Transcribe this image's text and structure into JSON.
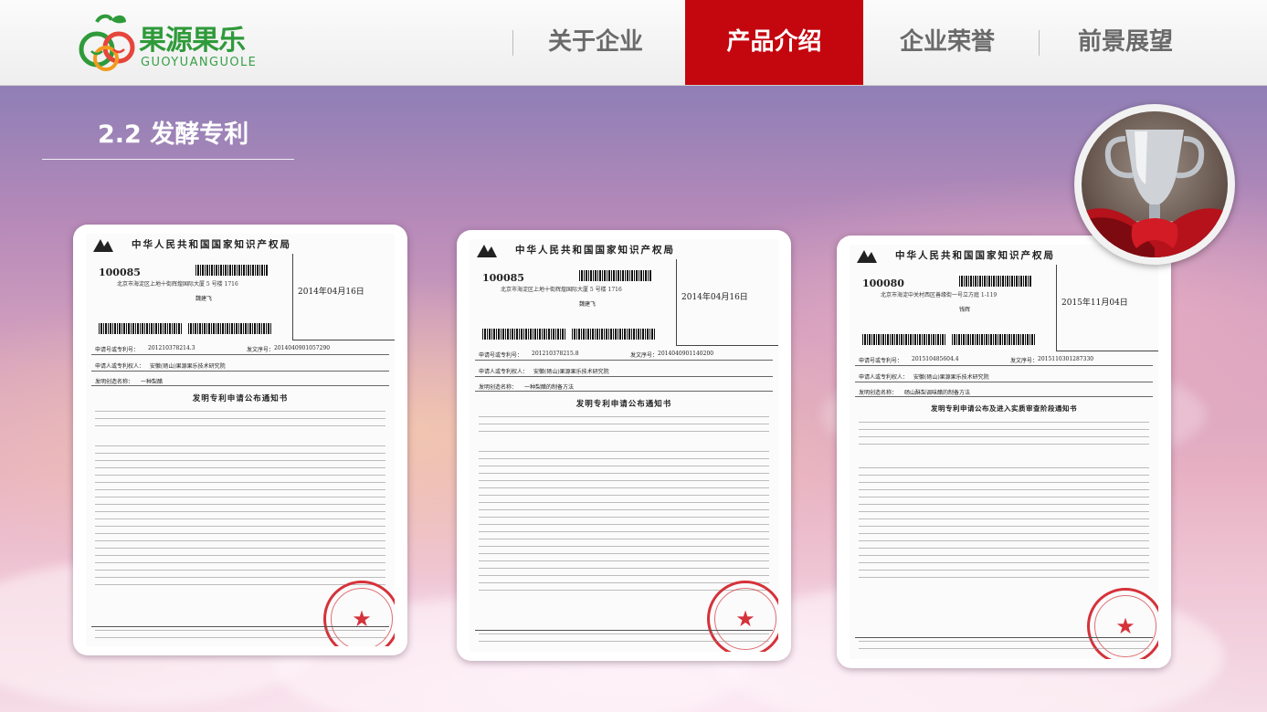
{
  "brand": {
    "name_cn": "果源果乐",
    "name_en": "GUOYUANGUOLE"
  },
  "nav": {
    "items": [
      {
        "label": "关于企业",
        "active": false
      },
      {
        "label": "产品介绍",
        "active": true
      },
      {
        "label": "企业荣誉",
        "active": false
      },
      {
        "label": "前景展望",
        "active": false
      }
    ]
  },
  "section": {
    "title": "2.2 发酵专利"
  },
  "documents": [
    {
      "office": "中华人民共和国国家知识产权局",
      "postcode": "100085",
      "address": "北京市海淀区上地十街辉煌国际大厦 5 号楼 1716",
      "recipient": "魏建飞",
      "date": "2014年04月16日",
      "app_no_label": "申请号或专利号：",
      "app_no": "201210378214.3",
      "doc_no_label": "发文序号：",
      "doc_no": "2014040901057290",
      "applicant_label": "申请人或专利权人：",
      "applicant": "安徽(砀山)果源果乐技术研究院",
      "invention_label": "发明创造名称：",
      "invention": "一种梨醋",
      "notice_title": "发明专利申请公布通知书"
    },
    {
      "office": "中华人民共和国国家知识产权局",
      "postcode": "100085",
      "address": "北京市海淀区上地十街辉煌国际大厦 5 号楼 1716",
      "recipient": "魏建飞",
      "date": "2014年04月16日",
      "app_no_label": "申请号或专利号：",
      "app_no": "201210378215.8",
      "doc_no_label": "发文序号：",
      "doc_no": "2014040901140200",
      "applicant_label": "申请人或专利权人：",
      "applicant": "安徽(砀山)果源果乐技术研究院",
      "invention_label": "发明创造名称：",
      "invention": "一种梨醋的制备方法",
      "notice_title": "发明专利申请公布通知书"
    },
    {
      "office": "中华人民共和国国家知识产权局",
      "postcode": "100080",
      "address": "北京市海淀中关村西区善缘街一号立方庭 1-119",
      "recipient": "钱辉",
      "date": "2015年11月04日",
      "app_no_label": "申请号或专利号：",
      "app_no": "201510485604.4",
      "doc_no_label": "发文序号：",
      "doc_no": "2015110301287330",
      "applicant_label": "申请人或专利权人：",
      "applicant": "安徽(砀山)果源果乐技术研究院",
      "invention_label": "发明创造名称：",
      "invention": "砀山酥梨调味醋的制备方法",
      "notice_title": "发明专利申请公布及进入实质审查阶段通知书"
    }
  ],
  "colors": {
    "nav_active_bg": "#c4060f",
    "brand_green": "#2f9a3a",
    "seal_red": "#d5323a"
  },
  "icons": {
    "logo": "fruit-logo-icon",
    "emblem": "cnipa-emblem-icon",
    "seal": "official-seal-icon",
    "trophy": "trophy-icon"
  }
}
